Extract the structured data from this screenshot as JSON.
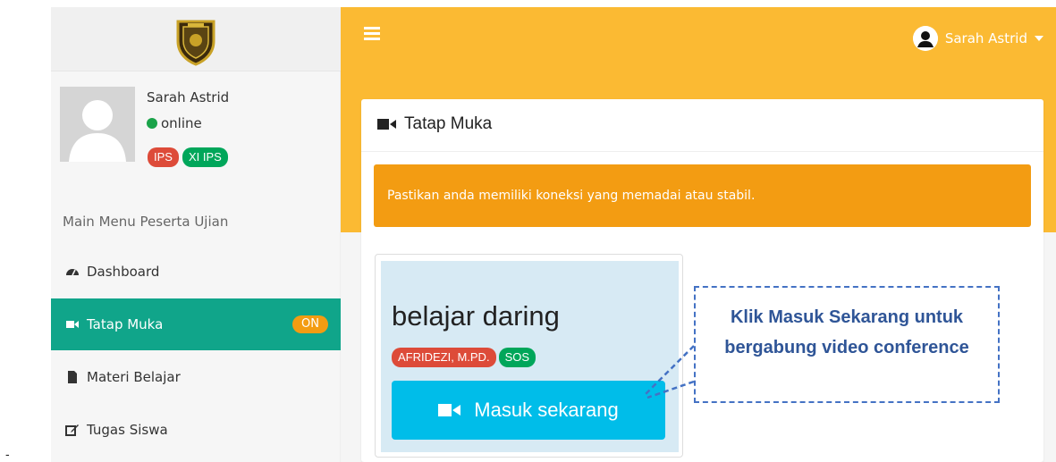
{
  "sidebar": {
    "user": {
      "name": "Sarah Astrid",
      "status": "online",
      "badges": [
        "IPS",
        "XI IPS"
      ]
    },
    "menu_header": "Main Menu Peserta Ujian",
    "items": [
      {
        "label": "Dashboard",
        "icon": "dashboard-icon"
      },
      {
        "label": "Tatap Muka",
        "icon": "video-camera-icon",
        "badge": "ON",
        "active": true
      },
      {
        "label": "Materi Belajar",
        "icon": "file-icon"
      },
      {
        "label": "Tugas Siswa",
        "icon": "edit-icon"
      }
    ]
  },
  "topbar": {
    "username": "Sarah Astrid"
  },
  "main": {
    "title": "Tatap Muka",
    "alert": "Pastikan anda memiliki koneksi yang memadai atau stabil.",
    "room": {
      "title": "belajar daring",
      "teacher": "AFRIDEZI, M.PD.",
      "subject": "SOS",
      "button": "Masuk sekarang"
    }
  },
  "callout": {
    "text": "Klik Masuk Sekarang untuk bergabung video conference"
  },
  "margin_mark": "-",
  "colors": {
    "header": "#fbba33",
    "active_menu": "#10a58a",
    "alert": "#f39c12",
    "join_button": "#00bde9",
    "badge_red": "#dd4b39",
    "badge_green": "#00a65a",
    "callout_border": "#4472c4"
  }
}
